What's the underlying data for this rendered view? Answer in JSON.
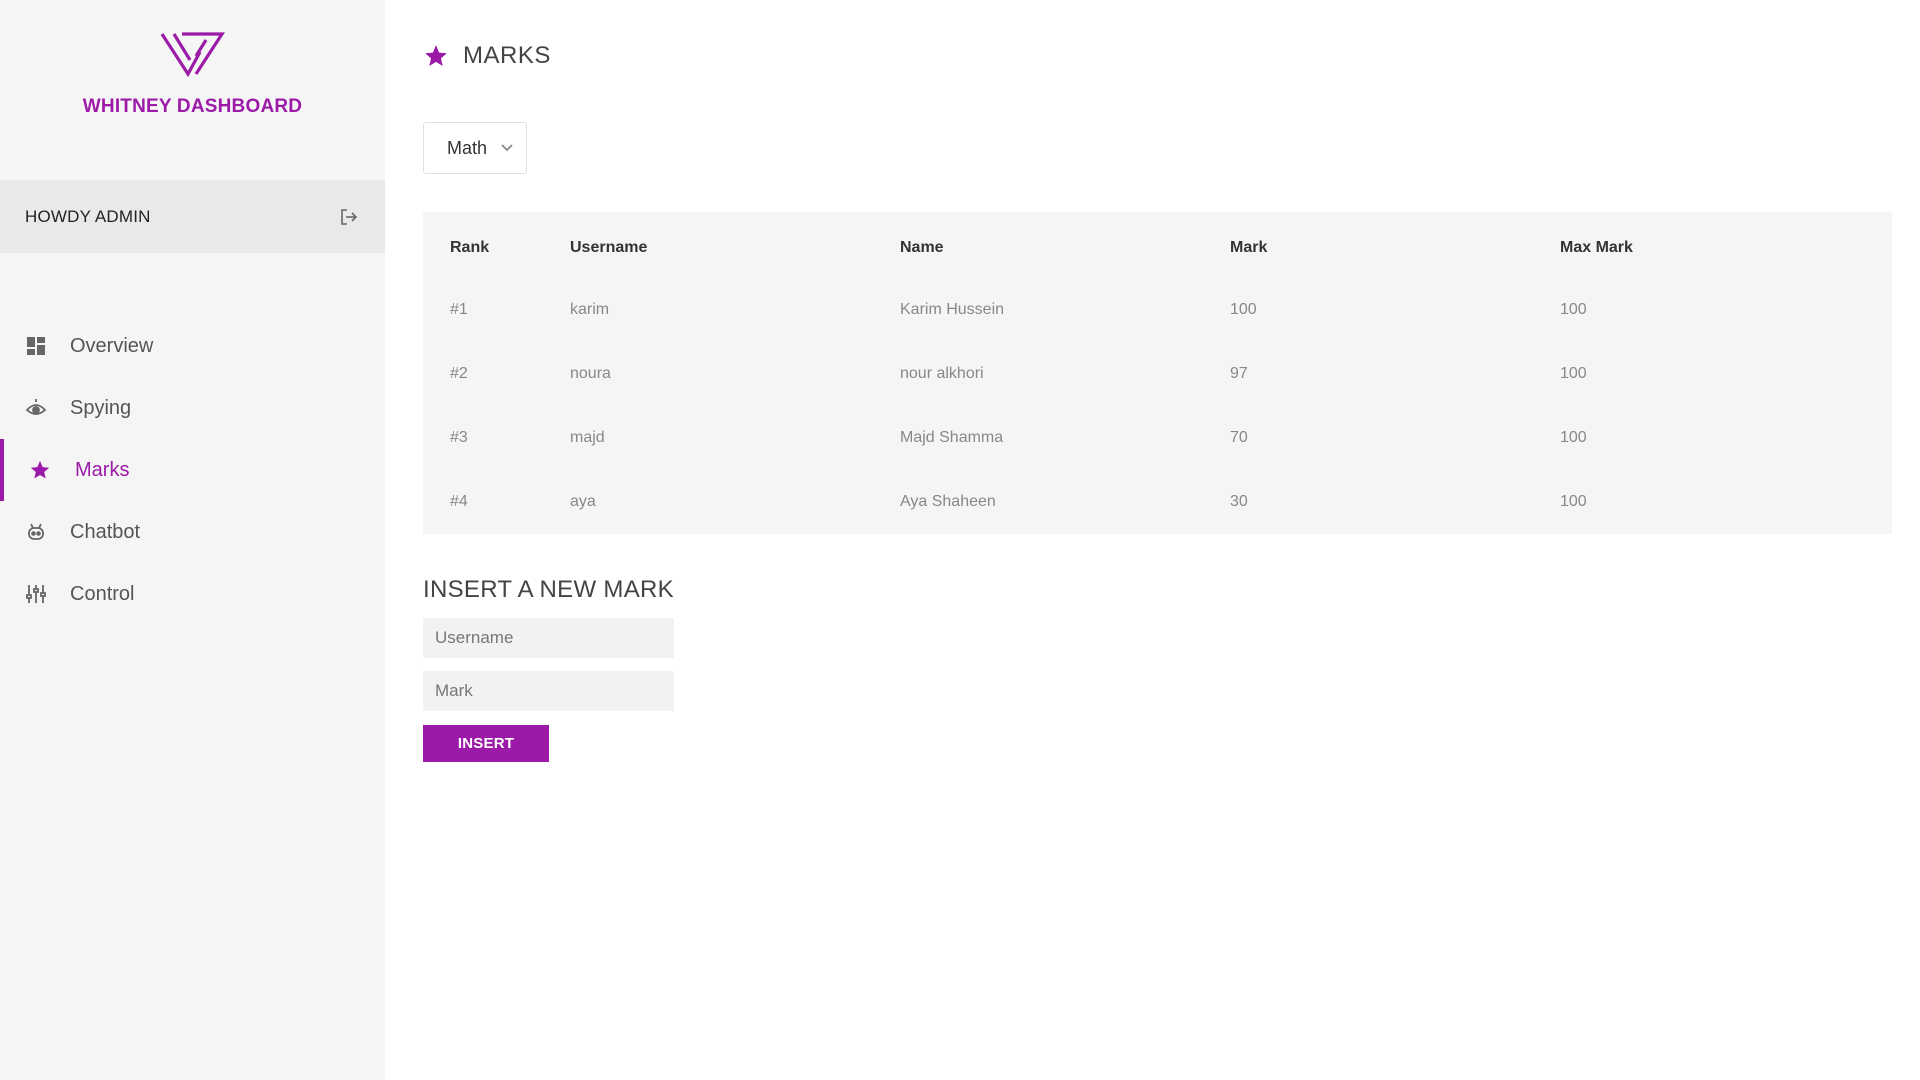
{
  "colors": {
    "accent": "#9c1aa8",
    "sidebar_bg": "#f5f5f5",
    "user_bar_bg": "#e9e9e9",
    "table_bg": "#f5f5f5"
  },
  "brand": {
    "title": "WHITNEY DASHBOARD",
    "logo_icon": "whitney-logo"
  },
  "user": {
    "greeting": "HOWDY ADMIN",
    "logout_icon": "logout-icon"
  },
  "nav": {
    "items": [
      {
        "label": "Overview",
        "icon": "dashboard-icon",
        "active": false
      },
      {
        "label": "Spying",
        "icon": "eye-icon",
        "active": false
      },
      {
        "label": "Marks",
        "icon": "star-icon",
        "active": true
      },
      {
        "label": "Chatbot",
        "icon": "robot-icon",
        "active": false
      },
      {
        "label": "Control",
        "icon": "sliders-icon",
        "active": false
      }
    ]
  },
  "page": {
    "title": "MARKS",
    "title_icon": "star-icon"
  },
  "subject_select": {
    "selected": "Math"
  },
  "table": {
    "headers": [
      "Rank",
      "Username",
      "Name",
      "Mark",
      "Max Mark"
    ],
    "rows": [
      [
        "#1",
        "karim",
        "Karim Hussein",
        "100",
        "100"
      ],
      [
        "#2",
        "noura",
        "nour alkhori",
        "97",
        "100"
      ],
      [
        "#3",
        "majd",
        "Majd Shamma",
        "70",
        "100"
      ],
      [
        "#4",
        "aya",
        "Aya Shaheen",
        "30",
        "100"
      ]
    ]
  },
  "insert_form": {
    "title": "INSERT A NEW MARK",
    "username_placeholder": "Username",
    "username_value": "",
    "mark_placeholder": "Mark",
    "mark_value": "",
    "submit_label": "INSERT"
  }
}
